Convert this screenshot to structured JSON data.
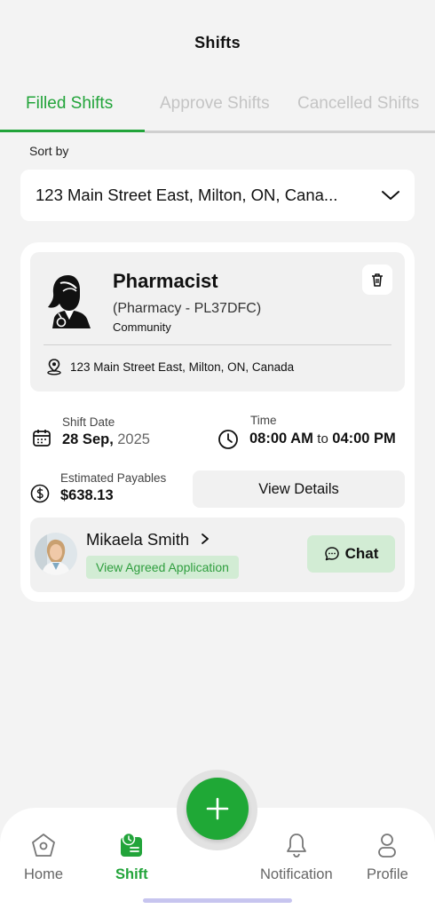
{
  "header": {
    "title": "Shifts"
  },
  "tabs": [
    {
      "label": "Filled Shifts",
      "active": true
    },
    {
      "label": "Approve Shifts",
      "active": false
    },
    {
      "label": "Cancelled Shifts",
      "active": false
    }
  ],
  "sort": {
    "label": "Sort by",
    "selected": "123 Main Street East, Milton, ON, Cana..."
  },
  "shift": {
    "role": "Pharmacist",
    "pharmacy": "(Pharmacy - PL37DFC)",
    "type": "Community",
    "address": "123 Main Street East, Milton, ON, Canada",
    "date_label": "Shift Date",
    "date_day": "28 Sep,",
    "date_year": "2025",
    "time_label": "Time",
    "time_start": "08:00 AM",
    "time_sep": "to",
    "time_end": "04:00 PM",
    "pay_label": "Estimated Payables",
    "pay_value": "$638.13",
    "view_details": "View Details"
  },
  "applicant": {
    "name": "Mikaela Smith",
    "link": "View Agreed Application",
    "chat": "Chat"
  },
  "nav": {
    "home": "Home",
    "shift": "Shift",
    "notification": "Notification",
    "profile": "Profile"
  },
  "colors": {
    "accent": "#22a43a",
    "fab": "#1fa836",
    "badge_bg": "#d2ecd4"
  }
}
